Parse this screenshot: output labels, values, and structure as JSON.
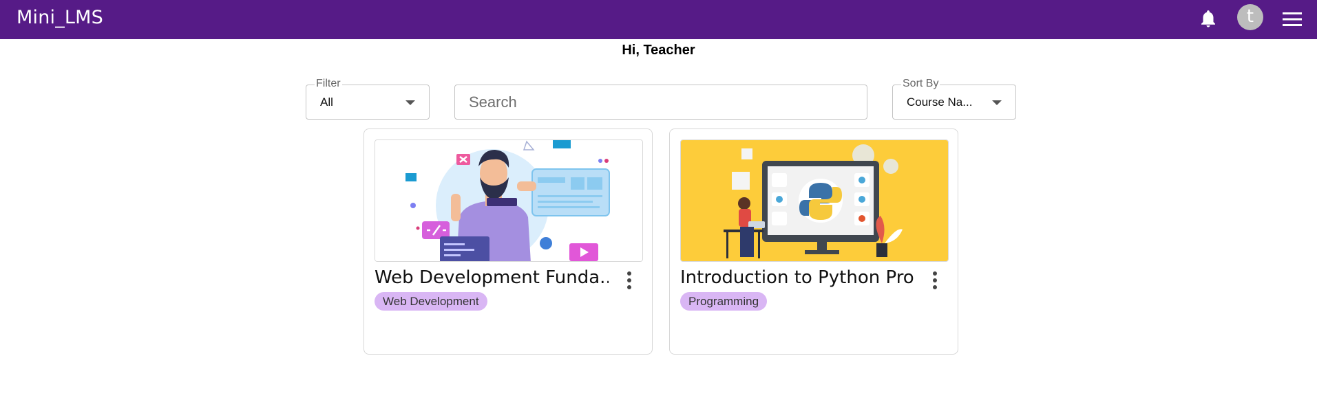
{
  "app": {
    "title": "Mini_LMS",
    "avatar_letter": "t",
    "accent_color": "#561b87"
  },
  "greeting": "Hi, Teacher",
  "filter": {
    "legend": "Filter",
    "value": "All"
  },
  "search": {
    "placeholder": "Search",
    "value": ""
  },
  "sort": {
    "legend": "Sort By",
    "value": "Course Na..."
  },
  "courses": [
    {
      "title": "Web Development Funda...",
      "tag": "Web Development",
      "image_icon": "web-design-illustration"
    },
    {
      "title": "Introduction to Python Pro...",
      "tag": "Programming",
      "image_icon": "python-monitor-illustration"
    }
  ],
  "icons": {
    "notifications": "bell-icon",
    "menu": "hamburger-icon",
    "more": "more-vertical-icon"
  }
}
